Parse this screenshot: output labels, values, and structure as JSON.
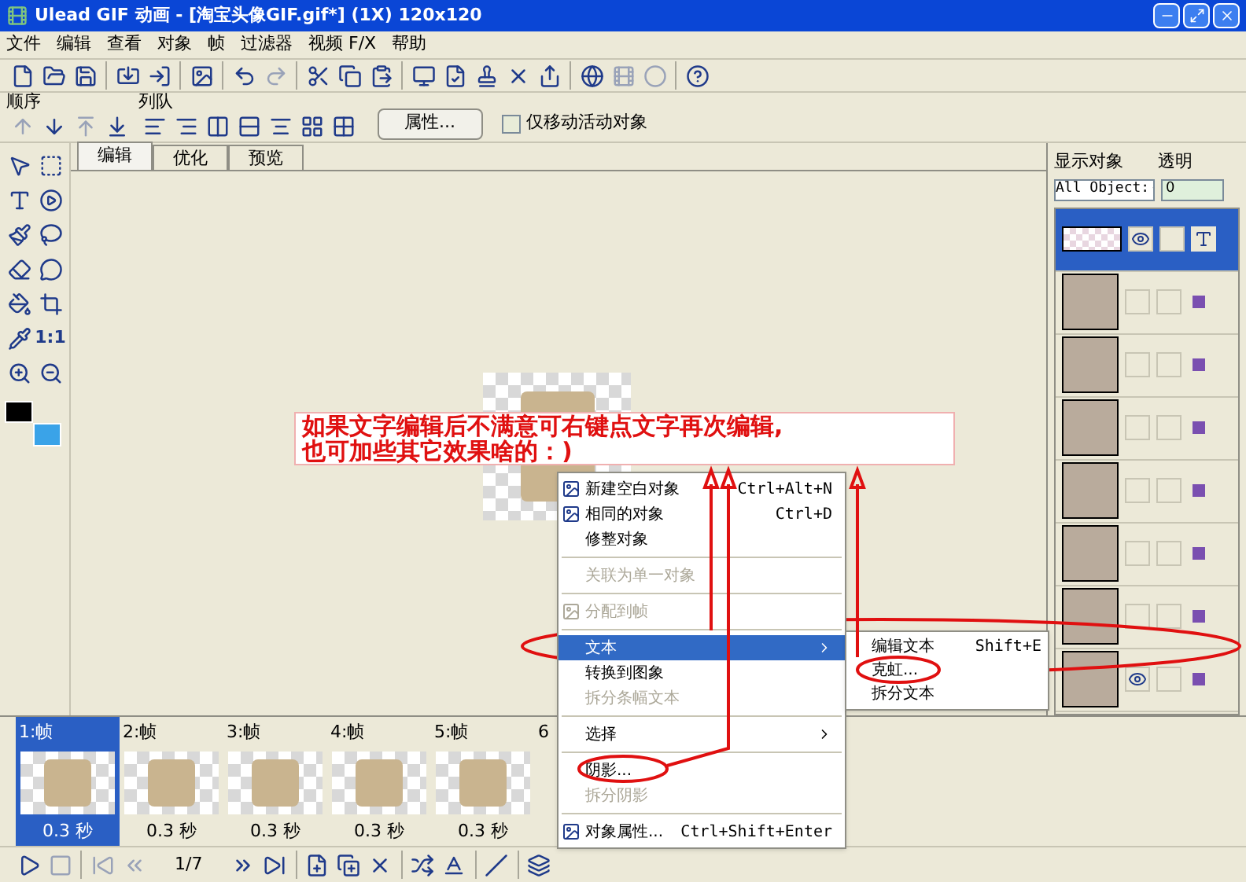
{
  "window": {
    "title": "Ulead GIF 动画 - [淘宝头像GIF.gif*]  (1X) 120x120"
  },
  "menu": [
    "文件",
    "编辑",
    "查看",
    "对象",
    "帧",
    "过滤器",
    "视频 F/X",
    "帮助"
  ],
  "arrange_toolbar": {
    "order_label": "顺序",
    "align_label": "列队",
    "properties_button": "属性...",
    "move_active_only": {
      "label": "仅移动活动对象",
      "checked": false
    }
  },
  "tools": {
    "actual_size": "1:1"
  },
  "tabs": [
    {
      "label": "编辑",
      "selected": true
    },
    {
      "label": "优化",
      "selected": false
    },
    {
      "label": "预览",
      "selected": false
    }
  ],
  "annotation": {
    "text": "如果文字编辑后不满意可右键点文字再次编辑,\n也可加些其它效果啥的：)"
  },
  "context_menu": [
    {
      "kind": "item",
      "label": "新建空白对象",
      "shortcut": "Ctrl+Alt+N",
      "icon": true,
      "disabled": false,
      "selected": false,
      "submenu": false
    },
    {
      "kind": "item",
      "label": "相同的对象",
      "shortcut": "Ctrl+D",
      "icon": true,
      "disabled": false,
      "selected": false,
      "submenu": false
    },
    {
      "kind": "item",
      "label": "修整对象",
      "disabled": false,
      "selected": false,
      "submenu": false
    },
    {
      "kind": "separator"
    },
    {
      "kind": "item",
      "label": "关联为单一对象",
      "disabled": true,
      "selected": false,
      "submenu": false
    },
    {
      "kind": "separator"
    },
    {
      "kind": "item",
      "label": "分配到帧",
      "icon": true,
      "disabled": true,
      "selected": false,
      "submenu": false
    },
    {
      "kind": "separator"
    },
    {
      "kind": "item",
      "label": "文本",
      "disabled": false,
      "selected": true,
      "submenu": true
    },
    {
      "kind": "item",
      "label": "转换到图象",
      "disabled": false,
      "selected": false,
      "submenu": false
    },
    {
      "kind": "item",
      "label": "拆分条幅文本",
      "disabled": true,
      "selected": false,
      "submenu": false
    },
    {
      "kind": "separator"
    },
    {
      "kind": "item",
      "label": "选择",
      "disabled": false,
      "selected": false,
      "submenu": true
    },
    {
      "kind": "separator"
    },
    {
      "kind": "item",
      "label": "阴影...",
      "disabled": false,
      "selected": false,
      "submenu": false
    },
    {
      "kind": "item",
      "label": "拆分阴影",
      "disabled": true,
      "selected": false,
      "submenu": false
    },
    {
      "kind": "separator"
    },
    {
      "kind": "item",
      "label": "对象属性...",
      "shortcut": "Ctrl+Shift+Enter",
      "icon": true,
      "disabled": false,
      "selected": false,
      "submenu": false
    }
  ],
  "submenu": [
    {
      "label": "编辑文本",
      "shortcut": "Shift+E"
    },
    {
      "label": "克虹..."
    },
    {
      "label": "拆分文本"
    }
  ],
  "object_panel": {
    "show_label": "显示对象",
    "opacity_label": "透明",
    "show_value": "All Object:",
    "opacity_value": "0",
    "layers": [
      {
        "kind": "text",
        "selected": true,
        "visible": true
      },
      {
        "kind": "image",
        "selected": false,
        "visible": false
      },
      {
        "kind": "image",
        "selected": false,
        "visible": false
      },
      {
        "kind": "image",
        "selected": false,
        "visible": false
      },
      {
        "kind": "image",
        "selected": false,
        "visible": false
      },
      {
        "kind": "image",
        "selected": false,
        "visible": false
      },
      {
        "kind": "image",
        "selected": false,
        "visible": false
      },
      {
        "kind": "image",
        "selected": false,
        "visible": true
      }
    ]
  },
  "frames": [
    {
      "label": "1:帧",
      "delay": "0.3 秒",
      "selected": true
    },
    {
      "label": "2:帧",
      "delay": "0.3 秒",
      "selected": false
    },
    {
      "label": "3:帧",
      "delay": "0.3 秒",
      "selected": false
    },
    {
      "label": "4:帧",
      "delay": "0.3 秒",
      "selected": false
    },
    {
      "label": "5:帧",
      "delay": "0.3 秒",
      "selected": false
    },
    {
      "label": "6",
      "selected": false
    }
  ],
  "frame_counter": "1/7"
}
